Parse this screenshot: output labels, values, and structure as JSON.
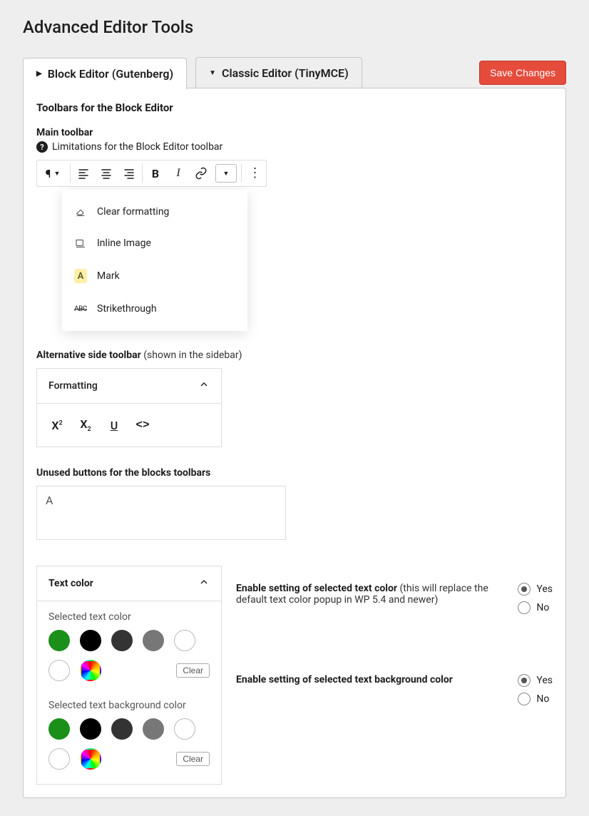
{
  "page_title": "Advanced Editor Tools",
  "save_label": "Save Changes",
  "tabs": {
    "block": "Block Editor (Gutenberg)",
    "classic": "Classic Editor (TinyMCE)"
  },
  "toolbars_heading": "Toolbars for the Block Editor",
  "main_toolbar_label": "Main toolbar",
  "limitations_text": "Limitations for the Block Editor toolbar",
  "dropdown": {
    "clear": "Clear formatting",
    "inline_image": "Inline Image",
    "mark": "Mark",
    "strike": "Strikethrough"
  },
  "alt_toolbar_label": "Alternative side toolbar",
  "alt_toolbar_suffix": "(shown in the sidebar)",
  "formatting_label": "Formatting",
  "unused_label": "Unused buttons for the blocks toolbars",
  "unused_content": "A",
  "text_color_label": "Text color",
  "selected_text_color": "Selected text color",
  "selected_bg_color": "Selected text background color",
  "clear_label": "Clear",
  "colors": [
    "#1a8f1a",
    "#000000",
    "#333333",
    "#777777"
  ],
  "enable_text_color_bold": "Enable setting of selected text color",
  "enable_text_color_rest": " (this will replace the default text color popup in WP 5.4 and newer)",
  "enable_bg_color_bold": "Enable setting of selected text background color",
  "yes": "Yes",
  "no": "No"
}
